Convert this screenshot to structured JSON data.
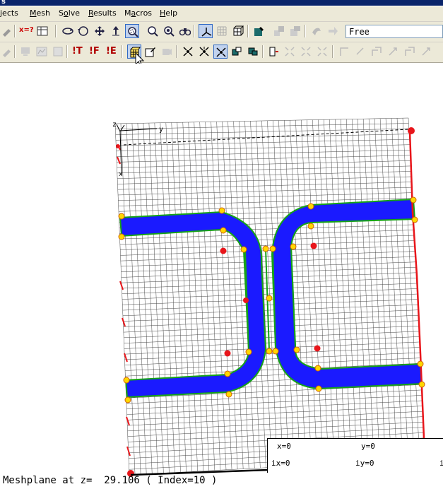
{
  "window": {
    "title": "s"
  },
  "menu": [
    {
      "key": "projects",
      "label": "jects"
    },
    {
      "key": "mesh",
      "label": "Mesh"
    },
    {
      "key": "solve",
      "label": "Solve"
    },
    {
      "key": "results",
      "label": "Results"
    },
    {
      "key": "macros",
      "label": "Macros"
    },
    {
      "key": "help",
      "label": "Help"
    }
  ],
  "toolbar1": {
    "xeq_label": "x=?",
    "view_mode_value": "Free"
  },
  "toolbar2": {
    "temp_label": "!T",
    "force_label": "!F",
    "field_label": "!E"
  },
  "axes": {
    "z_label": "z",
    "y_label": "y",
    "x_label": "x"
  },
  "coords": {
    "x": "x=0",
    "y": "y=0",
    "ix": "ix=0",
    "iy": "iy=0",
    "i_partial": "i"
  },
  "status": {
    "meshplane": "Meshplane at z=  29.106 ( Index=10 )"
  },
  "colors": {
    "conductor": "#1a1aff",
    "outline": "#16a316",
    "points": "#e8161b",
    "nodes": "#ffd800",
    "grid": "#4a4a4a"
  }
}
